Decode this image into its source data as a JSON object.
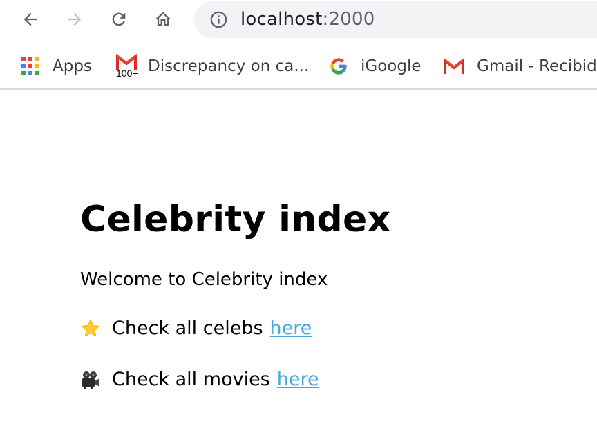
{
  "browser": {
    "url_host": "localhost",
    "url_port": ":2000",
    "bookmarks": [
      {
        "label": "Apps",
        "icon": "apps-grid-icon"
      },
      {
        "label": "Discrepancy on ca...",
        "icon": "gmail-icon",
        "badge": "100+"
      },
      {
        "label": "iGoogle",
        "icon": "google-g-icon"
      },
      {
        "label": "Gmail - Recibid",
        "icon": "gmail-icon"
      }
    ]
  },
  "page": {
    "title": "Celebrity index",
    "welcome": "Welcome to Celebrity index",
    "links": [
      {
        "emoji": "star-icon",
        "text": "Check all celebs",
        "link_text": "here"
      },
      {
        "emoji": "movie-camera-icon",
        "text": "Check all movies",
        "link_text": "here"
      }
    ]
  },
  "colors": {
    "link": "#4aa7e0",
    "omnibox_bg": "#f1f3f4",
    "divider": "#dadce0"
  }
}
